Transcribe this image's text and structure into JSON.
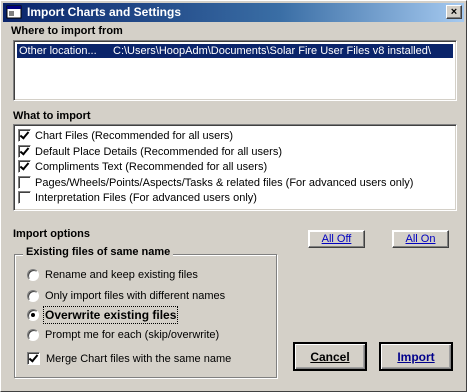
{
  "window": {
    "title": "Import Charts and Settings",
    "close_glyph": "×"
  },
  "where_section": {
    "label": "Where to import from",
    "rows": [
      {
        "name": "Other location...",
        "path": "C:\\Users\\HoopAdm\\Documents\\Solar Fire User Files v8 installed\\",
        "selected": true
      }
    ]
  },
  "what_section": {
    "label": "What to import",
    "items": [
      {
        "label": "Chart Files (Recommended for all users)",
        "checked": true
      },
      {
        "label": "Default Place Details (Recommended for all users)",
        "checked": true
      },
      {
        "label": "Compliments Text (Recommended for all users)",
        "checked": true
      },
      {
        "label": "Pages/Wheels/Points/Aspects/Tasks & related files (For advanced users only)",
        "checked": false
      },
      {
        "label": "Interpretation Files (For advanced users only)",
        "checked": false
      }
    ]
  },
  "import_options": {
    "label": "Import options",
    "all_off": "All Off",
    "all_on": "All On",
    "group_title": "Existing files of same name",
    "radios": [
      {
        "label": "Rename and keep existing files",
        "selected": false
      },
      {
        "label": "Only import files with different names",
        "selected": false
      },
      {
        "label": "Overwrite existing files",
        "selected": true
      },
      {
        "label": "Prompt me for each (skip/overwrite)",
        "selected": false
      }
    ],
    "merge_label": "Merge Chart files with the same name",
    "merge_checked": true
  },
  "buttons": {
    "cancel": "Cancel",
    "import": "Import"
  },
  "colors": {
    "titlebar_start": "#0a246a",
    "titlebar_end": "#a6caf0",
    "selection": "#0a246a",
    "face": "#d4d0c8"
  }
}
